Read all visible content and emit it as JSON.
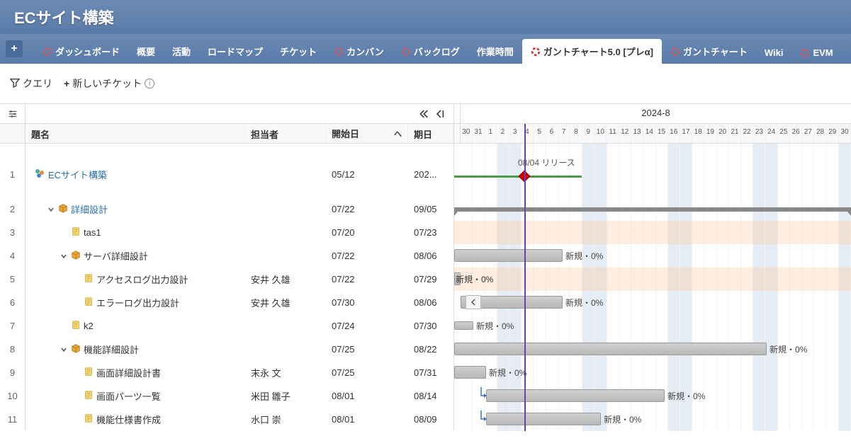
{
  "header": {
    "title": "ECサイト構築"
  },
  "nav": {
    "plus": "+",
    "tabs": [
      {
        "label": "ダッシュボード",
        "ring": true
      },
      {
        "label": "概要"
      },
      {
        "label": "活動"
      },
      {
        "label": "ロードマップ"
      },
      {
        "label": "チケット"
      },
      {
        "label": "カンバン",
        "ring": true
      },
      {
        "label": "バックログ",
        "ring": true
      },
      {
        "label": "作業時間"
      },
      {
        "label": "ガントチャート5.0 [プレα]",
        "ring": true,
        "active": true
      },
      {
        "label": "ガントチャート",
        "ring": true
      },
      {
        "label": "Wiki"
      },
      {
        "label": "EVM",
        "ring": true
      }
    ]
  },
  "toolbar": {
    "query": "クエリ",
    "new_ticket": "新しいチケット"
  },
  "columns": {
    "name": "題名",
    "assignee": "担当者",
    "start": "開始日",
    "due": "期日",
    "sort_indicator": "ヘ"
  },
  "gantt": {
    "month": "2024-8",
    "days": [
      "30",
      "31",
      "1",
      "2",
      "3",
      "4",
      "5",
      "6",
      "7",
      "8",
      "9",
      "10",
      "11",
      "12",
      "13",
      "14",
      "15",
      "16",
      "17",
      "18",
      "19",
      "20",
      "21",
      "22",
      "23",
      "24",
      "25",
      "26",
      "27",
      "28",
      "29",
      "30"
    ],
    "weekend_sat_idx": [
      3,
      10,
      17,
      24,
      31
    ],
    "weekend_sun_idx": [
      4,
      11,
      18,
      25
    ],
    "milestone": "08/04 リリース",
    "status_new_0": "新規・0%"
  },
  "rows": [
    {
      "num": "1",
      "name": "ECサイト構築",
      "assignee": "",
      "start": "05/12",
      "due": "202...",
      "type": "project",
      "link": true
    },
    {
      "num": "2",
      "name": "詳細設計",
      "assignee": "",
      "start": "07/22",
      "due": "09/05",
      "type": "package",
      "indent": 1,
      "expandable": true,
      "link": true
    },
    {
      "num": "3",
      "name": "tas1",
      "assignee": "",
      "start": "07/20",
      "due": "07/23",
      "type": "doc",
      "indent": 2
    },
    {
      "num": "4",
      "name": "サーバ詳細設計",
      "assignee": "",
      "start": "07/22",
      "due": "08/06",
      "type": "package",
      "indent": 2,
      "expandable": true
    },
    {
      "num": "5",
      "name": "アクセスログ出力設計",
      "assignee": "安井 久雄",
      "start": "07/22",
      "due": "07/29",
      "type": "doc",
      "indent": 3
    },
    {
      "num": "6",
      "name": "エラーログ出力設計",
      "assignee": "安井 久雄",
      "start": "07/30",
      "due": "08/06",
      "type": "doc",
      "indent": 3
    },
    {
      "num": "7",
      "name": "k2",
      "assignee": "",
      "start": "07/24",
      "due": "07/30",
      "type": "doc",
      "indent": 2
    },
    {
      "num": "8",
      "name": "機能詳細設計",
      "assignee": "",
      "start": "07/25",
      "due": "08/22",
      "type": "package",
      "indent": 2,
      "expandable": true
    },
    {
      "num": "9",
      "name": "画面詳細設計書",
      "assignee": "末永 文",
      "start": "07/25",
      "due": "07/31",
      "type": "doc",
      "indent": 3
    },
    {
      "num": "10",
      "name": "画面パーツ一覧",
      "assignee": "米田 雛子",
      "start": "08/01",
      "due": "08/14",
      "type": "doc",
      "indent": 3
    },
    {
      "num": "11",
      "name": "機能仕様書作成",
      "assignee": "水口 崇",
      "start": "08/01",
      "due": "08/09",
      "type": "doc",
      "indent": 3
    }
  ]
}
